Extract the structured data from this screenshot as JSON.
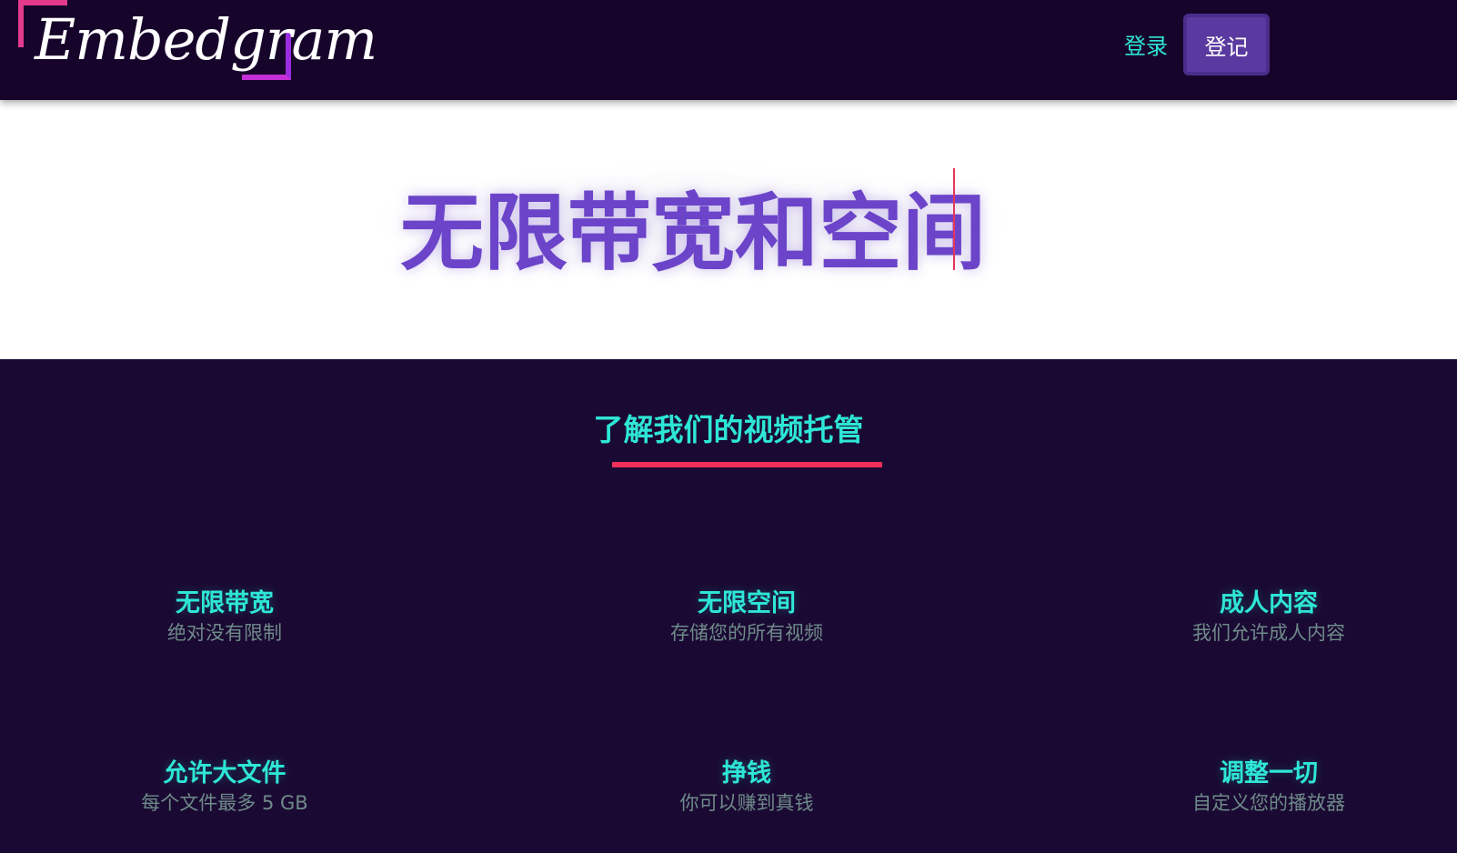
{
  "header": {
    "logo_text": "Embedgram",
    "login_label": "登录",
    "signup_label": "登记"
  },
  "hero": {
    "title": "无限带宽和空间"
  },
  "features": {
    "section_title": "了解我们的视频托管",
    "items": [
      {
        "title": "无限带宽",
        "desc": "绝对没有限制"
      },
      {
        "title": "无限空间",
        "desc": "存储您的所有视频"
      },
      {
        "title": "成人内容",
        "desc": "我们允许成人内容"
      },
      {
        "title": "允许大文件",
        "desc": "每个文件最多 5 GB"
      },
      {
        "title": "挣钱",
        "desc": "你可以赚到真钱"
      },
      {
        "title": "调整一切",
        "desc": "自定义您的播放器"
      }
    ]
  },
  "colors": {
    "nav_bg": "#17042b",
    "page_bg": "#1a0a33",
    "accent_teal": "#2ee6d6",
    "hero_purple": "#6b44c9",
    "underline_red": "#f0305a",
    "button_purple": "#5a3aa0"
  }
}
